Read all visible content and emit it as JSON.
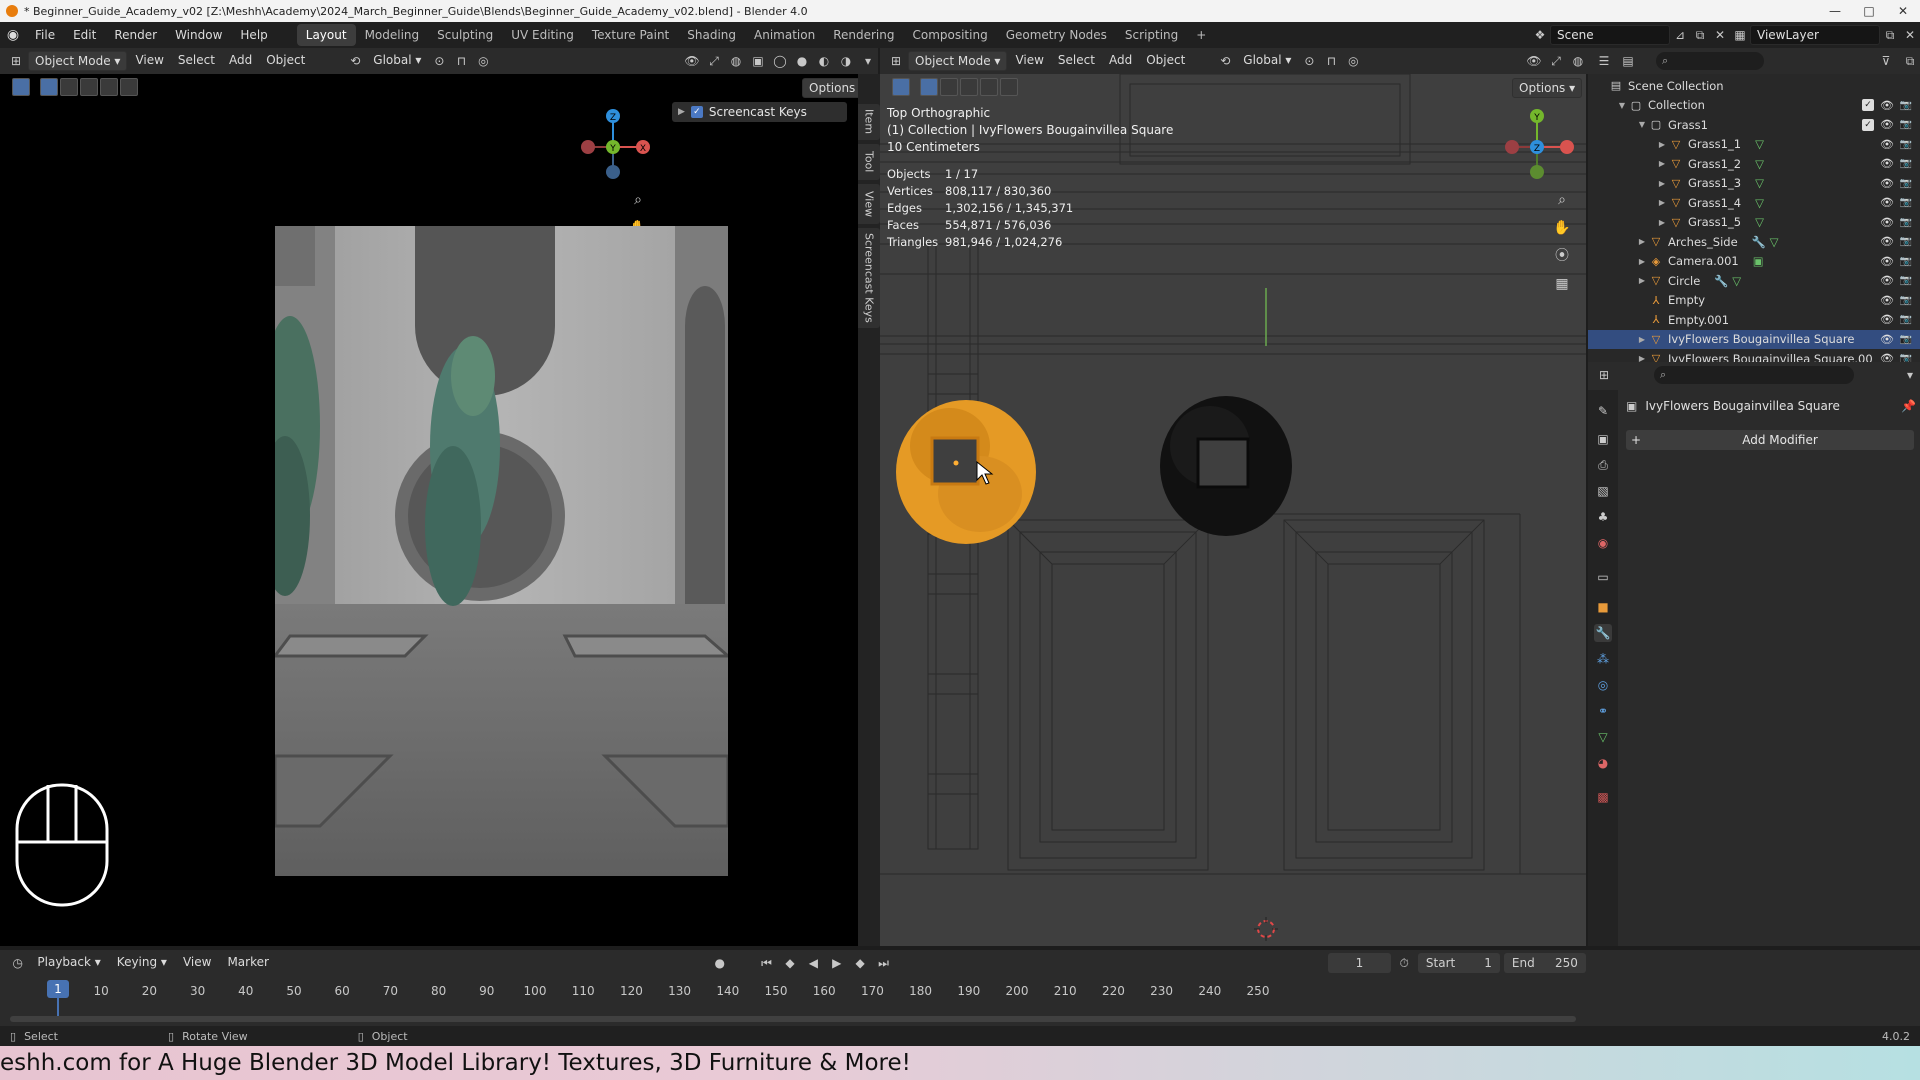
{
  "window": {
    "title": "* Beginner_Guide_Academy_v02 [Z:\\Meshh\\Academy\\2024_March_Beginner_Guide\\Blends\\Beginner_Guide_Academy_v02.blend] - Blender 4.0",
    "min": "—",
    "max": "□",
    "close": "✕"
  },
  "menus": [
    "File",
    "Edit",
    "Render",
    "Window",
    "Help"
  ],
  "workspaces": [
    "Layout",
    "Modeling",
    "Sculpting",
    "UV Editing",
    "Texture Paint",
    "Shading",
    "Animation",
    "Rendering",
    "Compositing",
    "Geometry Nodes",
    "Scripting"
  ],
  "workspace_add": "+",
  "scene": {
    "name": "Scene",
    "view_layer": "ViewLayer"
  },
  "left_viewport": {
    "mode": "Object Mode",
    "menu": [
      "View",
      "Select",
      "Add",
      "Object"
    ],
    "transform": "Global",
    "options": "Options",
    "screencast_label": "Screencast Keys",
    "gizmo": {
      "z": "Z",
      "y": "Y",
      "x": "X"
    }
  },
  "side_tabs": [
    "Item",
    "Tool",
    "View",
    "Screencast Keys"
  ],
  "right_viewport": {
    "mode": "Object Mode",
    "menu": [
      "View",
      "Select",
      "Add",
      "Object"
    ],
    "transform": "Global",
    "options": "Options",
    "view_name": "Top Orthographic",
    "collection_line": "(1) Collection | IvyFlowers Bougainvillea Square",
    "scale": "10 Centimeters",
    "stats": [
      {
        "label": "Objects",
        "value": "1 / 17"
      },
      {
        "label": "Vertices",
        "value": "808,117 / 830,360"
      },
      {
        "label": "Edges",
        "value": "1,302,156 / 1,345,371"
      },
      {
        "label": "Faces",
        "value": "554,871 / 576,036"
      },
      {
        "label": "Triangles",
        "value": "981,946 / 1,024,276"
      }
    ],
    "gizmo": {
      "y": "Y",
      "z": "Z"
    }
  },
  "outliner": {
    "rows": [
      {
        "name": "Scene Collection",
        "depth": 0,
        "icon": "scene-collection",
        "tri": ""
      },
      {
        "name": "Collection",
        "depth": 1,
        "icon": "collection",
        "tri": "▼",
        "check": true
      },
      {
        "name": "Grass1",
        "depth": 2,
        "icon": "collection",
        "tri": "▼",
        "check": true
      },
      {
        "name": "Grass1_1",
        "depth": 3,
        "icon": "mesh",
        "tri": "▶",
        "extra": "▽"
      },
      {
        "name": "Grass1_2",
        "depth": 3,
        "icon": "mesh",
        "tri": "▶",
        "extra": "▽"
      },
      {
        "name": "Grass1_3",
        "depth": 3,
        "icon": "mesh",
        "tri": "▶",
        "extra": "▽"
      },
      {
        "name": "Grass1_4",
        "depth": 3,
        "icon": "mesh",
        "tri": "▶",
        "extra": "▽"
      },
      {
        "name": "Grass1_5",
        "depth": 3,
        "icon": "mesh",
        "tri": "▶",
        "extra": "▽"
      },
      {
        "name": "Arches_Side",
        "depth": 2,
        "icon": "mesh",
        "tri": "▶",
        "extra": "🔧 ▽"
      },
      {
        "name": "Camera.001",
        "depth": 2,
        "icon": "camera",
        "tri": "▶",
        "extra": "▣"
      },
      {
        "name": "Circle",
        "depth": 2,
        "icon": "mesh",
        "tri": "▶",
        "extra": "🔧 ▽"
      },
      {
        "name": "Empty",
        "depth": 2,
        "icon": "empty",
        "tri": ""
      },
      {
        "name": "Empty.001",
        "depth": 2,
        "icon": "empty",
        "tri": ""
      },
      {
        "name": "IvyFlowers Bougainvillea Square",
        "depth": 2,
        "icon": "mesh",
        "tri": "▶",
        "selected": true
      },
      {
        "name": "IvyFlowers Bougainvillea Square.00",
        "depth": 2,
        "icon": "mesh",
        "tri": "▶"
      }
    ]
  },
  "properties": {
    "object_name": "IvyFlowers Bougainvillea Square",
    "add_modifier": "Add Modifier"
  },
  "timeline": {
    "menu": [
      "Playback",
      "Keying",
      "View",
      "Marker"
    ],
    "current_frame": "1",
    "start_label": "Start",
    "start": "1",
    "end_label": "End",
    "end": "250",
    "ticks": [
      "10",
      "20",
      "30",
      "40",
      "50",
      "60",
      "70",
      "80",
      "90",
      "100",
      "110",
      "120",
      "130",
      "140",
      "150",
      "160",
      "170",
      "180",
      "190",
      "200",
      "210",
      "220",
      "230",
      "240",
      "250"
    ],
    "playhead": "1"
  },
  "statusbar": {
    "select": "Select",
    "rotate": "Rotate View",
    "object": "Object",
    "version": "4.0.2"
  },
  "banner": "eshh.com for A Huge Blender 3D Model Library! Textures, 3D Furniture & More!"
}
